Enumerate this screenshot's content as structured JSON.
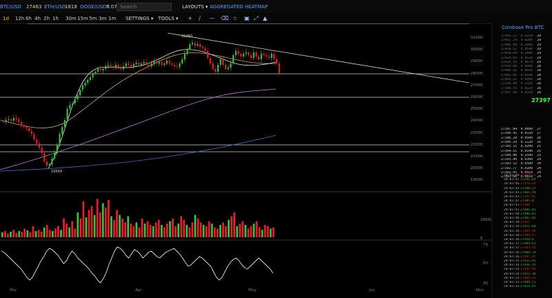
{
  "ticker": [
    {
      "symbol": "BTC/USD",
      "price": "27463"
    },
    {
      "symbol": "ETH/USD",
      "price": "1818"
    },
    {
      "symbol": "DOGE/USDT",
      "price": "0.071"
    }
  ],
  "search": {
    "placeholder": "Search"
  },
  "top_menu": {
    "layouts": "LAYOUTS",
    "heatmap": "AGGREGATED HEATMAP"
  },
  "timeframes": [
    "1d",
    "12h",
    "6h",
    "4h",
    "2h",
    "1h",
    "30m",
    "15m",
    "5m",
    "3m",
    "1m"
  ],
  "active_timeframe": "1d",
  "toolbar": {
    "settings": "SETTINGS",
    "tools": "TOOLS"
  },
  "icons": [
    "crosshair-icon",
    "trendline-icon",
    "horizontal-line-icon",
    "eraser-icon",
    "star-icon",
    "camera-icon",
    "fullscreen-icon",
    "alert-icon"
  ],
  "chart": {
    "price_axis": [
      "31000",
      "30000",
      "29000",
      "28000",
      "27000",
      "26000",
      "25000",
      "24000",
      "23000",
      "22000",
      "21000",
      "20000",
      "19000"
    ],
    "high_label": "31050",
    "low_label": "19569",
    "volume_axis": [
      "20000",
      "0"
    ],
    "rsi_axis": [
      "70",
      "50",
      "30"
    ],
    "x_axis": [
      "Mar",
      "Apr",
      "May",
      "Jun",
      "Nov"
    ]
  },
  "colors": {
    "up": "#3dbd3d",
    "down": "#e0202a",
    "accent": "#4aa8ff",
    "last": "#3dff3d"
  },
  "orderbook": {
    "title": "Coinbase Pro BTC",
    "asks": [
      {
        "p": "27460.27",
        "s": "0.0210",
        "r": "29"
      },
      {
        "p": "27452.24",
        "s": "0.0280",
        "r": "29"
      },
      {
        "p": "27440.00",
        "s": "0.1000",
        "r": "29"
      },
      {
        "p": "27436.12",
        "s": "0.0540",
        "r": "29"
      },
      {
        "p": "27428.64",
        "s": "0.2440",
        "r": "29"
      },
      {
        "p": "27420.03",
        "s": "0.0120",
        "r": "29"
      },
      {
        "p": "27415.55",
        "s": "0.0670",
        "r": "29"
      },
      {
        "p": "27410.00",
        "s": "0.4000",
        "r": "28"
      },
      {
        "p": "27406.16",
        "s": "0.0610",
        "r": "28"
      },
      {
        "p": "27402.85",
        "s": "0.0280",
        "r": "28"
      },
      {
        "p": "27400.31",
        "s": "0.0990",
        "r": "28"
      },
      {
        "p": "27399.80",
        "s": "0.1150",
        "r": "28"
      },
      {
        "p": "27398.53",
        "s": "0.0120",
        "r": "28"
      },
      {
        "p": "27397.90",
        "s": "0.0150",
        "r": "28"
      }
    ],
    "last": "27397",
    "bids": [
      {
        "p": "27397.84",
        "s": "0.0890",
        "r": "27"
      },
      {
        "p": "27396.41",
        "s": "0.0310",
        "r": "27"
      },
      {
        "p": "27396.20",
        "s": "0.0500",
        "r": "26"
      },
      {
        "p": "27395.29",
        "s": "0.1120",
        "r": "26"
      },
      {
        "p": "27395.15",
        "s": "0.0200",
        "r": "25"
      },
      {
        "p": "27394.51",
        "s": "0.0140",
        "r": "25"
      },
      {
        "p": "27394.00",
        "s": "0.2500",
        "r": "25"
      },
      {
        "p": "27393.40",
        "s": "0.0300",
        "r": "24"
      },
      {
        "p": "27393.12",
        "s": "0.0580",
        "r": "24"
      },
      {
        "p": "27392.77",
        "s": "0.0100",
        "r": "24"
      },
      {
        "p": "27392.05",
        "s": "0.0410",
        "r": "24"
      },
      {
        "p": "27391.60",
        "s": "0.0650",
        "r": "24"
      }
    ]
  },
  "trades": [
    {
      "t": "20:03:48",
      "p": "27389.22",
      "side": "sell"
    },
    {
      "t": "20:03:47",
      "p": "27391.84",
      "side": "buy"
    },
    {
      "t": "20:03:46",
      "p": "27378.24",
      "side": "sell"
    },
    {
      "t": "20:03:44",
      "p": "27398.27",
      "side": "buy"
    },
    {
      "t": "20:03:43",
      "p": "27401.54",
      "side": "buy"
    },
    {
      "t": "20:03:42",
      "p": "27393.05",
      "side": "sell"
    },
    {
      "t": "20:03:42",
      "p": "27395.8",
      "side": "buy"
    },
    {
      "t": "20:03:41",
      "p": "27400",
      "side": "sell"
    },
    {
      "t": "20:03:41",
      "p": "27401.01",
      "side": "buy"
    },
    {
      "t": "20:03:40",
      "p": "27406.61",
      "side": "buy"
    },
    {
      "t": "20:03:40",
      "p": "27401.05",
      "side": "buy"
    },
    {
      "t": "20:03:39",
      "p": "27401",
      "side": "sell"
    },
    {
      "t": "20:03:39",
      "p": "27411.68",
      "side": "buy"
    },
    {
      "t": "20:03:38",
      "p": "27408.99",
      "side": "sell"
    },
    {
      "t": "20:03:38",
      "p": "27409.47",
      "side": "sell"
    },
    {
      "t": "20:03:38",
      "p": "27418.6",
      "side": "buy"
    },
    {
      "t": "20:03:37",
      "p": "27409.61",
      "side": "buy"
    },
    {
      "t": "20:03:37",
      "p": "27403.56",
      "side": "sell"
    },
    {
      "t": "20:03:36",
      "p": "27408.78",
      "side": "buy"
    },
    {
      "t": "20:03:36",
      "p": "27407.45",
      "side": "sell"
    },
    {
      "t": "20:03:35",
      "p": "27411.91",
      "side": "buy"
    },
    {
      "t": "20:03:34",
      "p": "27410.35",
      "side": "buy"
    },
    {
      "t": "20:03:34",
      "p": "27403.98",
      "side": "sell"
    },
    {
      "t": "20:03:34",
      "p": "27412.26",
      "side": "buy"
    },
    {
      "t": "20:03:33",
      "p": "27406.14",
      "side": "sell"
    },
    {
      "t": "20:03:32",
      "p": "27409.51",
      "side": "buy"
    },
    {
      "t": "20:03:32",
      "p": "27424.41",
      "side": "buy"
    }
  ]
}
